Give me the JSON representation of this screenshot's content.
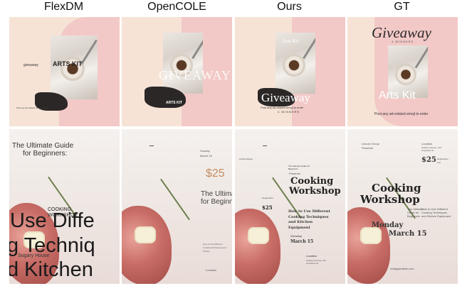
{
  "headers": [
    "FlexDM",
    "OpenCOLE",
    "Ours",
    "GT"
  ],
  "colors": {
    "peach": "#f6e3d6",
    "pink": "#f2c9c7",
    "brush": "#2b2727"
  },
  "row1": {
    "flexdm": {
      "small_left": "giveaway",
      "arts": "ARTS KIT",
      "footer": "Post any art-related emoji to enter"
    },
    "opencole": {
      "giveaway": "GIVEAWAY",
      "arts": "ARTS KIT"
    },
    "ours": {
      "arts": "Arts Kit",
      "giveaway": "Giveaway",
      "sub1": "Post any art-related emoji to enter",
      "sub2": "4 WINNERS"
    },
    "gt": {
      "giveaway": "Giveaway",
      "winners": "4 WINNERS",
      "arts": "Arts Kit",
      "post": "Post any art-related emoji to enter"
    }
  },
  "row2": {
    "flexdm": {
      "title1": "The Ultimate Guide",
      "title2": "for Beginners:",
      "cooking": "COOKING",
      "workshop": "WORKSHOP",
      "big1": "Use Diffe",
      "big2": "g Techniq",
      "big3": "d Kitchen",
      "house": "Sugary House"
    },
    "opencole": {
      "sunday": "Sunday",
      "march": "March 15",
      "price": "$25",
      "ultimate1": "The Ultima",
      "ultimate2": "for Beginne",
      "small": "How to Use Different Cooking Techniques and Kitchen",
      "location": "Location"
    },
    "ours": {
      "header": "Lincoln Group",
      "guide": "The Ultimate Guide for Beginners",
      "presents": "Presents",
      "cooking": "Cooking",
      "workshop": "Workshop",
      "price": "$25",
      "registration": "Registration",
      "how1": "How to Use Different",
      "how2": "Cooking Techniques",
      "how3": "and Kitchen",
      "how4": "Equipment",
      "monday": "Monday",
      "march": "March 15",
      "location": "Location",
      "address": "Hudson Avenue, 123 Anywhere St."
    },
    "gt": {
      "lincoln": "Lincoln Group",
      "presents": "Presents",
      "location": "Location",
      "address": "Hudson Avenue, 123 Anywhere St.",
      "price": "$25",
      "registration": "Registration",
      "fee": "Fee",
      "cooking": "Cooking",
      "workshop": "Workshop",
      "ultimate": "The Ultimate Guide for Beginners",
      "how": "How to Use Different Cooking Techniques and Kitchen Equipment",
      "monday": "Monday",
      "march": "March 15",
      "site": "reallygreatsite.com"
    }
  }
}
